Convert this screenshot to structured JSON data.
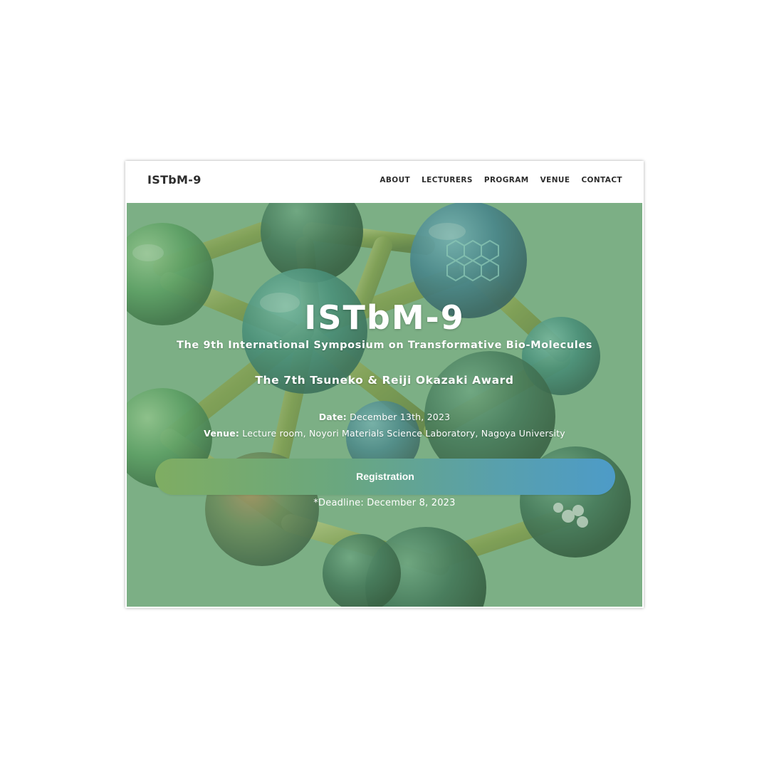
{
  "header": {
    "brand": "ISTbM-9",
    "nav": [
      "ABOUT",
      "LECTURERS",
      "PROGRAM",
      "VENUE",
      "CONTACT"
    ]
  },
  "hero": {
    "title": "ISTbM-9",
    "subtitle": "The 9th International Symposium on Transformative Bio-Molecules",
    "award": "The 7th Tsuneko & Reiji Okazaki Award",
    "date_label": "Date:",
    "date_value": " December 13th, 2023",
    "venue_label": "Venue:",
    "venue_value": " Lecture room, Noyori Materials Science Laboratory, Nagoya University",
    "registration_button": "Registration",
    "deadline": "*Deadline: December 8, 2023",
    "background_image": "molecular-structure-illustration"
  },
  "colors": {
    "overlay_green": "#70a878",
    "button_gradient_start": "#7fad62",
    "button_gradient_end": "#4d9bc8",
    "nav_text": "#2d2d2d"
  }
}
